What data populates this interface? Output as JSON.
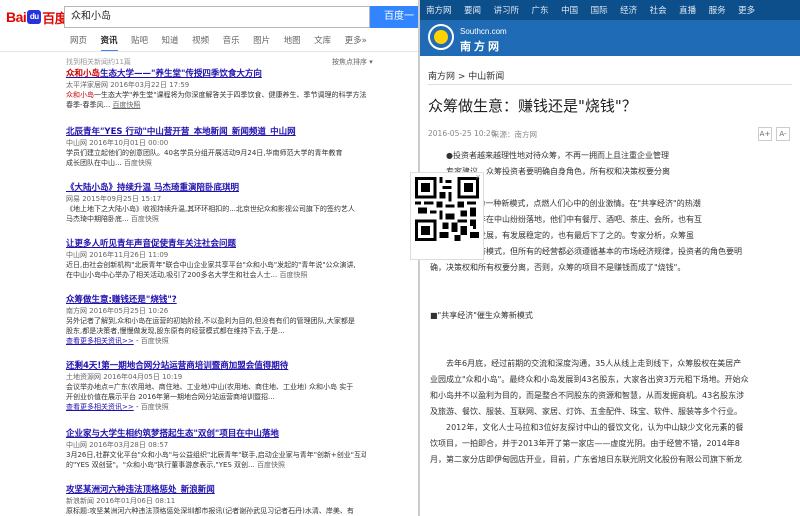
{
  "baidu": {
    "logo_text_1": "Bai",
    "logo_paw": "du",
    "logo_text_2": "百度",
    "search_value": "众和小岛",
    "search_button": "百度一下",
    "tabs": [
      "网页",
      "资讯",
      "贴吧",
      "知道",
      "视频",
      "音乐",
      "图片",
      "地图",
      "文库",
      "更多»"
    ],
    "active_tab": "资讯",
    "result_count": "找到相关新闻约11篇",
    "sort_label": "按焦点排序 ▾",
    "results": [
      {
        "title_pre": "",
        "title_hl": "众和小岛",
        "title_post": "生态大学——\"养生堂\"传授四季饮食大方向",
        "meta": "太平洋家居网  2016年03月22日 17:59",
        "desc_hl": "众和小岛",
        "desc": "一生态大学\"养生堂\"课程将为你深度解答关于四季饮食、健康养生、季节调理的科学方法。春季-春季风...",
        "snap": "百度快照"
      },
      {
        "title_pre": "北辰青年\"YES 行动\"中山营开营_本地新闻_新闻频道_中山网",
        "title_hl": "",
        "title_post": "",
        "meta": "中山网  2016年10月01日 00:00",
        "desc_hl": "",
        "desc": "学员们建立起他们的创意团队。40名学员分组开展活动9月24日,华南师范大学的青年教育",
        "desc2": "成长团队在中山...",
        "snap": "百度快照"
      },
      {
        "title_pre": "《大陆小岛》持续升温 马杰琦重演陪卧底琪明",
        "title_hl": "",
        "title_post": "",
        "meta": "网易  2015年09月25日 15:17",
        "desc_hl": "",
        "desc": "《地上地下之大陆小岛》收视持续升温,其环环相扣的...北京世纪众和影视公司旗下的签约艺人",
        "desc2": "马杰琦中期陪卧底...",
        "snap": "百度快照"
      },
      {
        "title_pre": "让更多人听见青年声音促使青年关注社会问题",
        "title_hl": "",
        "title_post": "",
        "meta": "中山网  2016年11月26日 11:09",
        "desc_hl": "众和小岛",
        "desc": "近日,由社会创新机构\"北辰青年\"联合中山企业家共享平台\"众和小岛\"发起的\"青年说\"公众演讲,",
        "desc2": "在中山小岛中心举办了相关活动,吸引了200多名大学生和社会人士...",
        "snap": "百度快照"
      },
      {
        "title_pre": "众筹做生意:赚钱还是\"烧钱\"?",
        "title_hl": "",
        "title_post": "",
        "meta": "南方网  2016年05月25日 10:26",
        "desc_hl": "众和小岛",
        "desc": "另外记者了解到,众和小岛在运营的初始阶段,不以盈利为目的,但没有有们的管理团队,大家都是",
        "desc2": "股东,都是决策者,慢慢做发现,股东原有的经营模式都在维持下去,于是...",
        "more": "查看更多相关资讯>>",
        "snap": "百度快照"
      },
      {
        "title_pre": "还剩4天!第一期地合网分站运营商培训暨商加盟会值得期待",
        "title_hl": "",
        "title_post": "",
        "meta": "土地资源网  2016年04月05日 10:19",
        "desc_hl": "众和小岛",
        "desc": "会议举办地点=广东(农用地、商住地、工业地)中山(农用地、商住地、工业地) 众和小岛 实于",
        "desc2": "开创业价值在展示平台 2016年第一期地合网分站运营商培训暨招...",
        "more": "查看更多相关资讯>>",
        "snap": "百度快照"
      },
      {
        "title_pre": "企业家与大学生相约筑梦搭起生态\"双创\"项目在中山落地",
        "title_hl": "",
        "title_post": "",
        "meta": "中山网  2016年03月28日 08:57",
        "desc_hl": "众和小岛",
        "desc": "3月26日,社群文化平台\"众和小岛\"与公益组织\"北辰青年\"联手,启动企业家与青年\"创新+创业\"互动",
        "desc2": "的\"YES 双创营\"。\"众和小岛\"执行董事游彦表示,\"YES 双创...",
        "snap": "百度快照"
      },
      {
        "title_pre": "攻坚某洲河六种违法顶格惩处_新浪新闻",
        "title_hl": "",
        "title_post": "",
        "meta": "新浪新闻  2016年01月06日 08:11",
        "desc_hl": "",
        "desc": "原标题:攻坚某洲河六种违法顶格惩处深圳都市报讯(记者谢孙武见习记者石丹)水清、岸美、有",
        "snap": ""
      }
    ]
  },
  "southcn": {
    "nav": [
      "南方网",
      "要闻",
      "讲习所",
      "广东",
      "中国",
      "国际",
      "经济",
      "社会",
      "直播",
      "服务",
      "更多"
    ],
    "domain": "Southcn.com",
    "site_name": "南方网",
    "breadcrumb": "南方网 > 中山新闻",
    "title": "众筹做生意：赚钱还是\"烧钱\"？",
    "date": "2016-05-25 10:26",
    "source": "来源：南方网",
    "font_up": "A+",
    "font_down": "A-",
    "paragraphs": [
      {
        "text": "●投资者越来越理性地对待众筹，不再一拥而上且注重企业管理",
        "indent": true
      },
      {
        "text": "专家建议，众筹投资者要明确自身角色，所有权和决策权要分离",
        "indent": true
      },
      {
        "text": "",
        "indent": false
      },
      {
        "text": "\"众筹\"作为一种新模式，点燃人们心中的创业激情。在\"共享经济\"的热潮",
        "indent": true
      },
      {
        "text": "项目近两年在中山纷纷落地，他们中有餐厅、酒吧、茶庄、会所，也有互",
        "indent": true
      },
      {
        "text": "一两年的发展，有发展稳定的，也有最后下了之的。专家分析，众筹虽",
        "indent": true
      },
      {
        "text": "然是一种新经济模式，但所有的经营都必须遵循基本的市场经济规律，投资者的角色要明",
        "indent": false
      },
      {
        "text": "确，决策权和所有权要分离，否则，众筹的项目不是赚钱而成了\"烧钱\"。",
        "indent": false
      },
      {
        "text": "",
        "indent": false
      },
      {
        "text": "",
        "indent": false
      },
      {
        "text": "■\"共享经济\"催生众筹新模式",
        "indent": false
      },
      {
        "text": "",
        "indent": false
      },
      {
        "text": "",
        "indent": false
      },
      {
        "text": "去年6月底，经过前期的交流和深度沟通，35人从线上走到线下，众筹股权在美居产",
        "indent": true
      },
      {
        "text": "业园成立\"众和小岛\"。最终众和小岛发展到43名股东，大家各出资3万元租下场地。开始众",
        "indent": false
      },
      {
        "text": "和小岛并不以盈利为目的，而是整合不同股东的资源和智慧，从而发掘商机。43名股东涉",
        "indent": false
      },
      {
        "text": "及旅游、餐饮、服装、互联网、家居、灯饰、五金配件、珠宝、软件、服装等多个行业。",
        "indent": false
      },
      {
        "text": "2012年，文化人士马拉和3位好友探讨中山的餐饮文化，认为中山缺少文化元素的餐",
        "indent": true
      },
      {
        "text": "饮项目，一拍即合，并于2013年开了第一家店——虚度光阴。由于经营不错，2014年8",
        "indent": false
      },
      {
        "text": "月，第二家分店即伊甸园店开业，目前，广东省旭日东联光阴文化股份有限公司旗下新龙",
        "indent": false
      }
    ],
    "qr_close": "×"
  }
}
